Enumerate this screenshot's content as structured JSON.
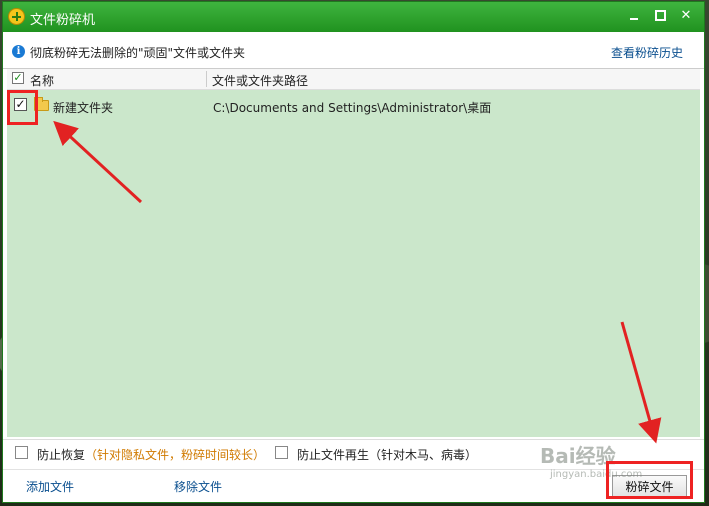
{
  "window": {
    "title": "文件粉碎机",
    "minimize_icon": "minimize-icon",
    "maximize_icon": "maximize-icon",
    "close_icon": "close-icon",
    "title_color": "#2a9a2a"
  },
  "info": {
    "icon": "info-icon",
    "text": "彻底粉碎无法删除的\"顽固\"文件或文件夹",
    "history_link": "查看粉碎历史"
  },
  "table": {
    "columns": [
      "名称",
      "文件或文件夹路径"
    ],
    "header_checked": true,
    "rows": [
      {
        "checked": true,
        "icon": "folder-icon",
        "name": "新建文件夹",
        "path": "C:\\Documents and Settings\\Administrator\\桌面"
      }
    ],
    "list_bg": "#cbe7cb"
  },
  "options": {
    "prevent_recovery": {
      "label": "防止恢复",
      "hint": "（针对隐私文件，粉碎时间较长）",
      "checked": false
    },
    "prevent_regen": {
      "label": "防止文件再生",
      "hint": "（针对木马、病毒）",
      "checked": false
    }
  },
  "footer": {
    "add_files": "添加文件",
    "remove_files": "移除文件",
    "shred_button": "粉碎文件"
  },
  "annotations": {
    "highlight_color": "#e22222"
  },
  "watermark": {
    "text": "Bai经验",
    "sub": "jingyan.baidu.com"
  }
}
